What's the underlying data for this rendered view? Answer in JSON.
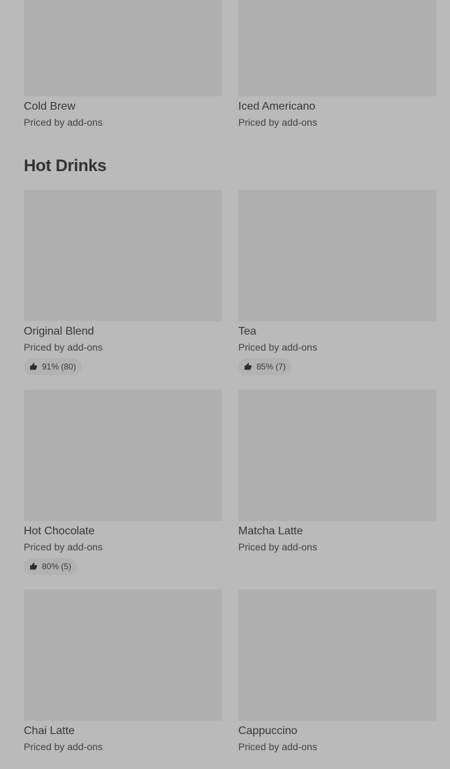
{
  "top_items": [
    {
      "name": "Cold Brew",
      "price": "Priced by add-ons"
    },
    {
      "name": "Iced Americano",
      "price": "Priced by add-ons"
    }
  ],
  "section": {
    "title": "Hot Drinks"
  },
  "hot_drinks": [
    {
      "name": "Original Blend",
      "price": "Priced by add-ons",
      "rating": "91% (80)"
    },
    {
      "name": "Tea",
      "price": "Priced by add-ons",
      "rating": "85% (7)"
    },
    {
      "name": "Hot Chocolate",
      "price": "Priced by add-ons",
      "rating": "80% (5)"
    },
    {
      "name": "Matcha Latte",
      "price": "Priced by add-ons"
    },
    {
      "name": "Chai Latte",
      "price": "Priced by add-ons"
    },
    {
      "name": "Cappuccino",
      "price": "Priced by add-ons"
    }
  ],
  "icons": {
    "rating": "thumbs-up-icon"
  },
  "colors": {
    "background": "#bababa",
    "image_placeholder": "#b0b0b0",
    "text": "#363636"
  }
}
